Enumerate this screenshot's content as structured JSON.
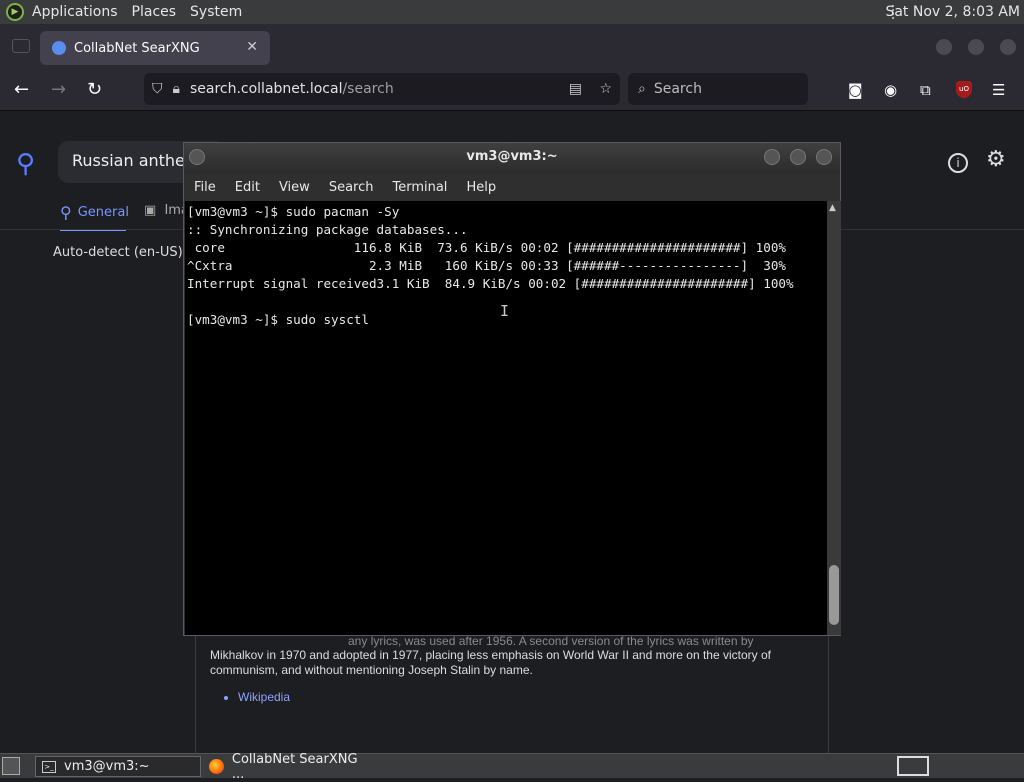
{
  "top_panel": {
    "menus": [
      "Applications",
      "Places",
      "System"
    ],
    "clock": "Sat Nov 2,  8:03 AM"
  },
  "browser": {
    "tab_title": "CollabNet SearXNG",
    "url_domain": "search.collabnet.local",
    "url_path": "/search",
    "search_placeholder": "Search"
  },
  "page": {
    "query": "Russian anthem",
    "tab_general": "General",
    "tab_images": "Ima",
    "language": "Auto-detect (en-US)",
    "card_cut_line": "any lyrics, was used after 1956. A second version of the lyrics was written by",
    "card_text": "Mikhalkov in 1970 and adopted in 1977, placing less emphasis on World War II and more on the victory of communism, and without mentioning Joseph Stalin by name.",
    "card_link": "Wikipedia"
  },
  "terminal": {
    "title": "vm3@vm3:~",
    "menu": [
      "File",
      "Edit",
      "View",
      "Search",
      "Terminal",
      "Help"
    ],
    "lines": [
      "[vm3@vm3 ~]$ sudo pacman -Sy",
      ":: Synchronizing package databases...",
      " core                 116.8 KiB  73.6 KiB/s 00:02 [######################] 100%",
      "^Cxtra                  2.3 MiB   160 KiB/s 00:33 [######----------------]  30%",
      "Interrupt signal received3.1 KiB  84.9 KiB/s 00:02 [######################] 100%",
      "",
      "[vm3@vm3 ~]$ sudo sysctl"
    ]
  },
  "taskbar": {
    "items": [
      "vm3@vm3:~",
      "CollabNet SearXNG ..."
    ]
  },
  "colors": {
    "accent": "#7b95ff",
    "terminal_bg": "#000000",
    "panel_bg": "#3a3b3d"
  }
}
